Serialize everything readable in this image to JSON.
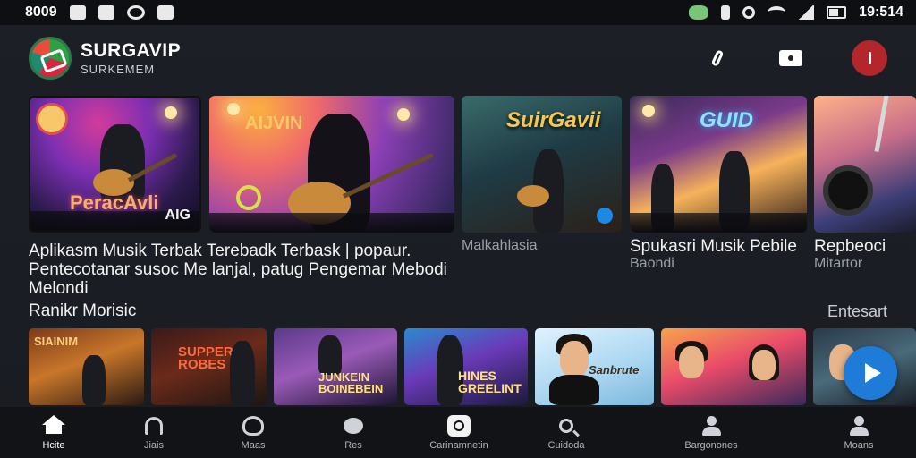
{
  "status_bar": {
    "time_left": "8009",
    "time_right": "19:514"
  },
  "header": {
    "app_name": "SURGAVIP",
    "app_subtitle": "SURKEMEM"
  },
  "featured": [
    {
      "title": "Aplikasm Musik Terbak Terebadk Terbask | popaur. Pentecotanar susoc Me lanjal, patug Pengemar Mebodi Melondi",
      "subtitle": "",
      "thumb_caption": "PeracAvli",
      "thumb_badge": "AIG"
    },
    {
      "title": "",
      "subtitle": "",
      "thumb_caption": "AIJVIN",
      "thumb_badge": ""
    },
    {
      "title": "",
      "subtitle": "Malkahlasia",
      "thumb_caption": "SuirGavii",
      "thumb_badge": ""
    },
    {
      "title": "Spukasri Musik Pebile",
      "subtitle": "Baondi",
      "thumb_caption": "GUID",
      "thumb_badge": ""
    },
    {
      "title": "Repbeoci",
      "subtitle": "Mitartor",
      "thumb_caption": "",
      "thumb_badge": ""
    }
  ],
  "section": {
    "title": "Ranikr Morisic",
    "more_label": "Entesart"
  },
  "row2": [
    {
      "caption": "SIAINIM"
    },
    {
      "caption": "SUPPER ROBES"
    },
    {
      "caption": "JUNKEIN BOINEBEIN"
    },
    {
      "caption": "HINES GREELINT"
    },
    {
      "caption": "Sanbrute"
    },
    {
      "caption": ""
    },
    {
      "caption": ""
    }
  ],
  "bottom_nav": [
    {
      "label": "Hcite",
      "icon": "home-icon",
      "active": true
    },
    {
      "label": "Jiais",
      "icon": "stat-icon",
      "active": false
    },
    {
      "label": "Maas",
      "icon": "ring-icon",
      "active": false
    },
    {
      "label": "Res",
      "icon": "bubble-icon",
      "active": false
    },
    {
      "label": "Carinamnetin",
      "icon": "center-icon",
      "active": false
    },
    {
      "label": "Cuidoda",
      "icon": "search-icon",
      "active": false
    },
    {
      "label": "Bargonones",
      "icon": "profile-icon",
      "active": false
    },
    {
      "label": "Moans",
      "icon": "user-icon",
      "active": false
    }
  ],
  "colors": {
    "accent": "#1e7bd8",
    "profile": "#b3262b",
    "background": "#1c1f26"
  }
}
